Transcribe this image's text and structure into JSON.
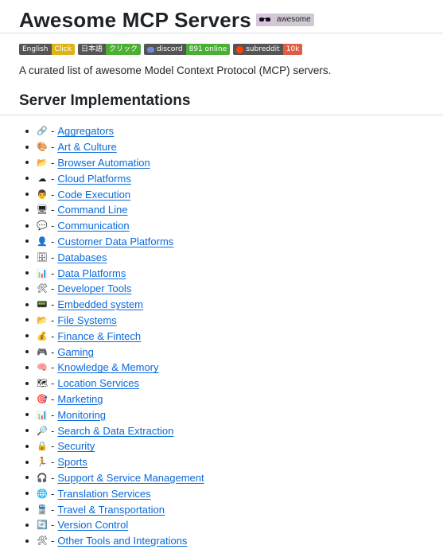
{
  "header": {
    "title": "Awesome MCP Servers",
    "awesome_badge": "awesome"
  },
  "badges": [
    {
      "left": "English",
      "right": "Click",
      "right_color": "#dfb317"
    },
    {
      "left": "日本語",
      "right": "クリック",
      "right_color": "#4caf35"
    },
    {
      "left": "discord",
      "right": "891 online",
      "right_color": "#4caf35",
      "icon": "discord-icon"
    },
    {
      "left": "subreddit",
      "right": "10k",
      "right_color": "#e05d44",
      "icon": "reddit-icon"
    }
  ],
  "intro": "A curated list of awesome Model Context Protocol (MCP) servers.",
  "section_title": "Server Implementations",
  "items": [
    {
      "emoji": "🔗",
      "icon": "link-icon",
      "label": "Aggregators"
    },
    {
      "emoji": "🎨",
      "icon": "palette-icon",
      "label": "Art & Culture"
    },
    {
      "emoji": "📂",
      "icon": "folder-icon",
      "label": "Browser Automation"
    },
    {
      "emoji": "☁",
      "icon": "cloud-icon",
      "label": "Cloud Platforms"
    },
    {
      "emoji": "👨",
      "icon": "technologist-icon",
      "label": "Code Execution"
    },
    {
      "emoji": "🖥",
      "icon": "desktop-icon",
      "label": "Command Line"
    },
    {
      "emoji": "💬",
      "icon": "speech-bubble-icon",
      "label": "Communication"
    },
    {
      "emoji": "👤",
      "icon": "person-icon",
      "label": "Customer Data Platforms"
    },
    {
      "emoji": "🗄",
      "icon": "file-cabinet-icon",
      "label": "Databases"
    },
    {
      "emoji": "📊",
      "icon": "bar-chart-icon",
      "label": "Data Platforms"
    },
    {
      "emoji": "🛠",
      "icon": "tools-icon",
      "label": "Developer Tools"
    },
    {
      "emoji": "📟",
      "icon": "pager-icon",
      "label": "Embedded system"
    },
    {
      "emoji": "📂",
      "icon": "open-folder-icon",
      "label": "File Systems"
    },
    {
      "emoji": "💰",
      "icon": "money-bag-icon",
      "label": "Finance & Fintech"
    },
    {
      "emoji": "🎮",
      "icon": "game-controller-icon",
      "label": "Gaming"
    },
    {
      "emoji": "🧠",
      "icon": "brain-icon",
      "label": "Knowledge & Memory"
    },
    {
      "emoji": "🗺",
      "icon": "map-icon",
      "label": "Location Services"
    },
    {
      "emoji": "🎯",
      "icon": "target-icon",
      "label": "Marketing"
    },
    {
      "emoji": "📊",
      "icon": "chart-icon",
      "label": "Monitoring"
    },
    {
      "emoji": "🔎",
      "icon": "magnifier-icon",
      "label": "Search & Data Extraction"
    },
    {
      "emoji": "🔒",
      "icon": "lock-icon",
      "label": "Security"
    },
    {
      "emoji": "🏃",
      "icon": "runner-icon",
      "label": "Sports"
    },
    {
      "emoji": "🎧",
      "icon": "headphones-icon",
      "label": "Support & Service Management"
    },
    {
      "emoji": "🌐",
      "icon": "globe-icon",
      "label": "Translation Services"
    },
    {
      "emoji": "🚆",
      "icon": "train-icon",
      "label": "Travel & Transportation"
    },
    {
      "emoji": "🔄",
      "icon": "refresh-icon",
      "label": "Version Control"
    },
    {
      "emoji": "🛠",
      "icon": "tools-icon",
      "label": "Other Tools and Integrations"
    }
  ]
}
